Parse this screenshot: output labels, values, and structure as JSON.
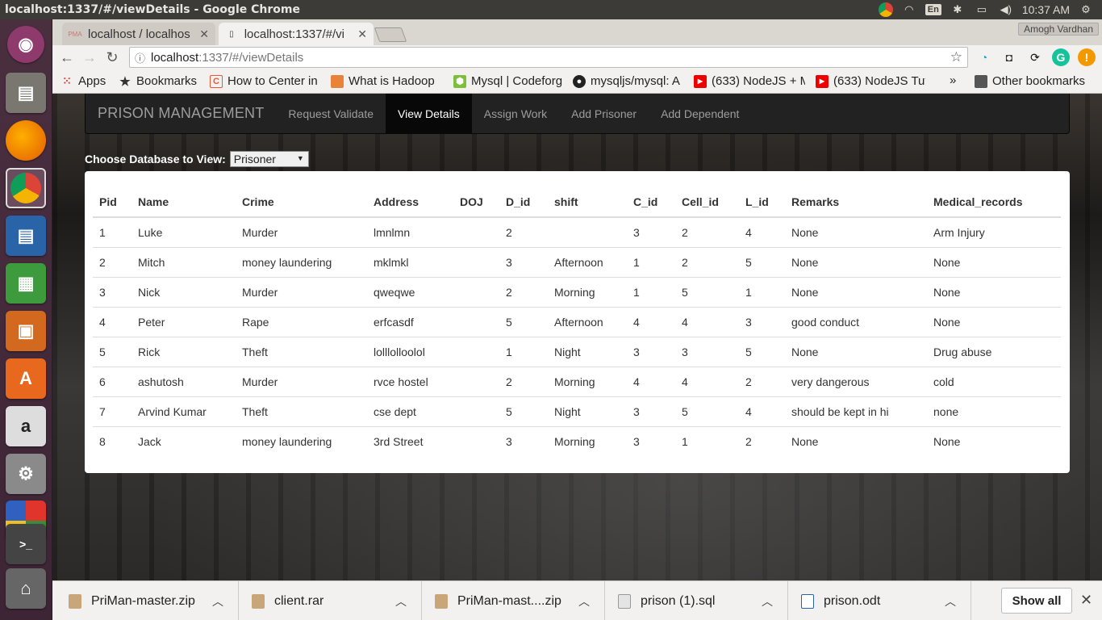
{
  "window": {
    "title": "localhost:1337/#/viewDetails - Google Chrome"
  },
  "system_tray": {
    "lang": "En",
    "time": "10:37 AM"
  },
  "tabs": [
    {
      "title": "localhost / localhos",
      "favicon": "PMA"
    },
    {
      "title": "localhost:1337/#/vi"
    }
  ],
  "profile": "Amogh Vardhan",
  "address": {
    "host": "localhost",
    "path": ":1337/#/viewDetails"
  },
  "bookmarks": [
    {
      "label": "Apps"
    },
    {
      "label": "Bookmarks"
    },
    {
      "label": "How to Center in"
    },
    {
      "label": "What is Hadoop"
    },
    {
      "label": "Mysql | Codeforg"
    },
    {
      "label": "mysqljs/mysql: A"
    },
    {
      "label": "(633) NodeJS + M"
    },
    {
      "label": "(633) NodeJS Tut"
    },
    {
      "label": "Other bookmarks"
    }
  ],
  "overflow": "»",
  "nav": {
    "brand": "PRISON MANAGEMENT",
    "links": [
      "Request Validate",
      "View Details",
      "Assign Work",
      "Add Prisoner",
      "Add Dependent"
    ]
  },
  "chooser": {
    "label": "Choose Database to View:",
    "selected": "Prisoner"
  },
  "table": {
    "headers": [
      "Pid",
      "Name",
      "Crime",
      "Address",
      "DOJ",
      "D_id",
      "shift",
      "C_id",
      "Cell_id",
      "L_id",
      "Remarks",
      "Medical_records"
    ],
    "rows": [
      [
        "1",
        "Luke",
        "Murder",
        "lmnlmn",
        "",
        "2",
        "",
        "3",
        "2",
        "4",
        "None",
        "Arm Injury"
      ],
      [
        "2",
        "Mitch",
        "money laundering",
        "mklmkl",
        "",
        "3",
        "Afternoon",
        "1",
        "2",
        "5",
        "None",
        "None"
      ],
      [
        "3",
        "Nick",
        "Murder",
        "qweqwe",
        "",
        "2",
        "Morning",
        "1",
        "5",
        "1",
        "None",
        "None"
      ],
      [
        "4",
        "Peter",
        "Rape",
        "erfcasdf",
        "",
        "5",
        "Afternoon",
        "4",
        "4",
        "3",
        "good conduct",
        "None"
      ],
      [
        "5",
        "Rick",
        "Theft",
        "lolllolloolol",
        "",
        "1",
        "Night",
        "3",
        "3",
        "5",
        "None",
        "Drug abuse"
      ],
      [
        "6",
        "ashutosh",
        "Murder",
        "rvce hostel",
        "",
        "2",
        "Morning",
        "4",
        "4",
        "2",
        "very dangerous",
        "cold"
      ],
      [
        "7",
        "Arvind Kumar",
        "Theft",
        "cse dept",
        "",
        "5",
        "Night",
        "3",
        "5",
        "4",
        "should be kept in hi",
        "none"
      ],
      [
        "8",
        "Jack",
        "money laundering",
        "3rd Street",
        "",
        "3",
        "Morning",
        "3",
        "1",
        "2",
        "None",
        "None"
      ]
    ]
  },
  "downloads": [
    {
      "name": "PriMan-master.zip",
      "icon": "zip-icon"
    },
    {
      "name": "client.rar",
      "icon": "archive-icon"
    },
    {
      "name": "PriMan-mast....zip",
      "icon": "zip-icon"
    },
    {
      "name": "prison (1).sql",
      "icon": "text-file-icon"
    },
    {
      "name": "prison.odt",
      "icon": "document-icon"
    }
  ],
  "show_all": "Show all"
}
